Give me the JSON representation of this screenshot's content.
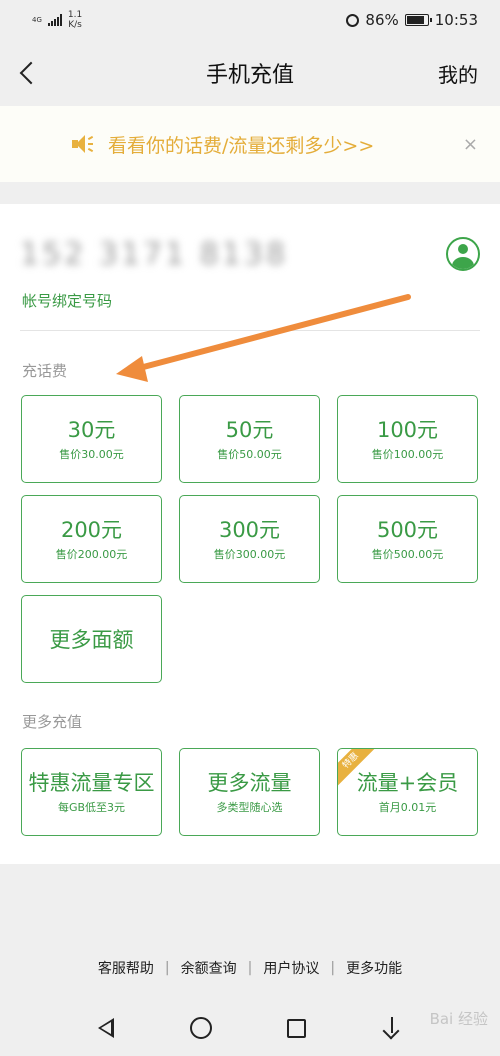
{
  "status_bar": {
    "network": "4G",
    "speed_value": "1.1",
    "speed_unit": "K/s",
    "battery": "86%",
    "battery_level": 0.86,
    "time": "10:53"
  },
  "nav": {
    "title": "手机充值",
    "mine": "我的"
  },
  "notice": {
    "text": "看看你的话费/流量还剩多少>>",
    "close": "×"
  },
  "account": {
    "phone_number": "152 3171 8138",
    "bound_label": "帐号绑定号码"
  },
  "recharge": {
    "title": "充话费",
    "options": [
      {
        "amount": "30元",
        "price": "售价30.00元"
      },
      {
        "amount": "50元",
        "price": "售价50.00元"
      },
      {
        "amount": "100元",
        "price": "售价100.00元"
      },
      {
        "amount": "200元",
        "price": "售价200.00元"
      },
      {
        "amount": "300元",
        "price": "售价300.00元"
      },
      {
        "amount": "500元",
        "price": "售价500.00元"
      }
    ],
    "more_label": "更多面额"
  },
  "more_recharge": {
    "title": "更多充值",
    "items": [
      {
        "title": "特惠流量专区",
        "subtitle": "每GB低至3元"
      },
      {
        "title": "更多流量",
        "subtitle": "多类型随心选"
      },
      {
        "title": "流量+会员",
        "subtitle": "首月0.01元",
        "badge": "特惠"
      }
    ]
  },
  "footer": {
    "links": [
      "客服帮助",
      "余额查询",
      "用户协议",
      "更多功能"
    ]
  },
  "watermark": "Bai 经验",
  "colors": {
    "accent_green": "#3a9a45",
    "notice_yellow": "#e4ad3a",
    "arrow_orange": "#ef8c3c"
  }
}
